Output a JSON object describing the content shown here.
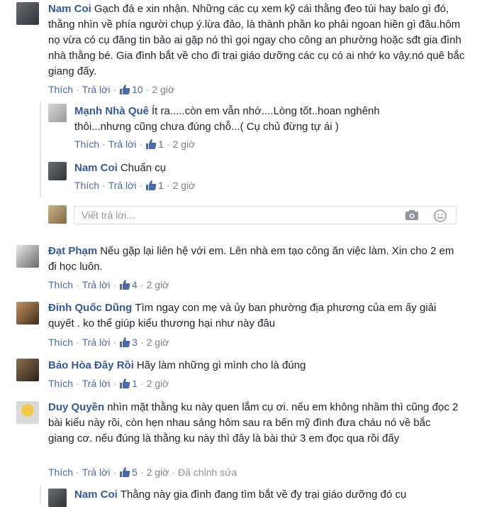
{
  "comments": [
    {
      "author": "Nam Coi",
      "text": "Gạch đá e xin nhận. Những các cụ xem kỹ cái thằng đeo túi hay balo gì đó, thằng nhìn về phía người chụp ý.lừa đảo, là thành phần ko phải ngoan hiền gì đâu.hôm nọ vừa có cụ đăng tin bảo ai gặp nó thì gọi ngay cho công an phường hoặc sđt gia đình nhà thằng bé. Gia đình bắt về cho đi trại giáo dưỡng các cụ có ai nhớ ko vậy.nó quê bắc giang đấy.",
      "like": "Thích",
      "reply": "Trả lời",
      "likes": "10",
      "time": "2 giờ"
    },
    {
      "author": "Đạt Phạm",
      "text": "Nếu gặp lại liên hệ với em. Lên nhà em tạo công ăn việc làm. Xin cho 2 em đi học luôn.",
      "like": "Thích",
      "reply": "Trả lời",
      "likes": "4",
      "time": "2 giờ"
    },
    {
      "author": "Đinh Quốc Dũng",
      "text": "Tìm ngay con mẹ và ủy ban phường địa phương của em ấy giải quyết . ko thể giúp kiểu thương hại như này đâu",
      "like": "Thích",
      "reply": "Trả lời",
      "likes": "3",
      "time": "2 giờ"
    },
    {
      "author": "Bảo Hòa Đây Rồi",
      "text": "Hãy làm những gì mình cho là đúng",
      "like": "Thích",
      "reply": "Trả lời",
      "likes": "1",
      "time": "2 giờ"
    },
    {
      "author": "Duy Quyền",
      "text": "nhìn mặt thằng ku này quen lắm cụ ơi. nếu em không nhầm thì cũng đọc 2 bài kiểu này rồi, còn hẹn nhau sáng hôm sau ra bến mỹ đình đưa cháu nó về bắc giang cơ. nếu đúng là thằng ku này thì đây là bài thứ 3 em đọc qua rồi đấy",
      "like": "Thích",
      "reply": "Trả lời",
      "likes": "5",
      "time": "2 giờ",
      "edited": "Đã chỉnh sửa"
    }
  ],
  "replies": [
    {
      "author": "Mạnh Nhà Quê",
      "text": "Ít ra.....còn em vẫn nhớ....Lòng tốt..hoan nghênh thôi...nhưng cũng chưa đúng chỗ...( Cụ chủ đừng tự ái )",
      "like": "Thích",
      "reply": "Trả lời",
      "likes": "1",
      "time": "2 giờ"
    },
    {
      "author": "Nam Coi",
      "text": "Chuẩn cụ",
      "like": "Thích",
      "reply": "Trả lời",
      "likes": "1",
      "time": "2 giờ"
    },
    {
      "author": "Nam Coi",
      "text": "Thằng này gia đình đang tìm bắt về đy trại giáo dưỡng đó cụ"
    }
  ],
  "reply_box": {
    "placeholder": "Viết trả lời...",
    "camera_icon": "camera-icon",
    "emoji_icon": "emoji-icon"
  },
  "colors": {
    "name": "#365899",
    "link": "#4b6aa8",
    "meta": "#90949c"
  }
}
